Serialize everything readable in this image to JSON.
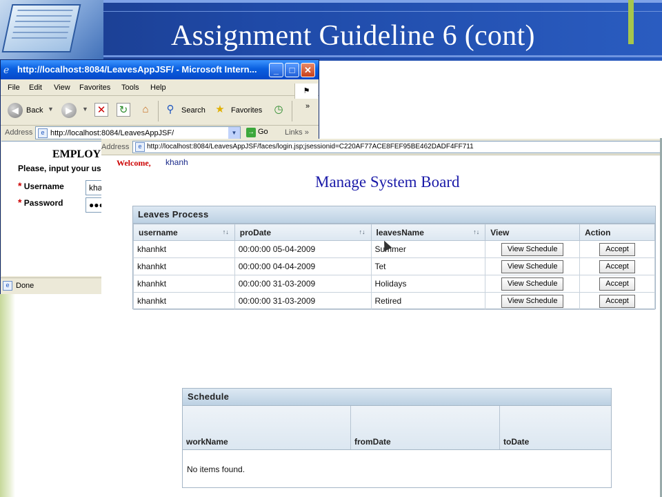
{
  "slide": {
    "title": "Assignment Guideline 6 (cont)"
  },
  "ie_window": {
    "title": "http://localhost:8084/LeavesAppJSF/ - Microsoft Intern...",
    "controls": {
      "minimize": "_",
      "maximize": "□",
      "close": "✕"
    },
    "menu": [
      "File",
      "Edit",
      "View",
      "Favorites",
      "Tools",
      "Help"
    ],
    "toolbar": {
      "back": "Back",
      "search": "Search",
      "favorites": "Favorites",
      "more": "»"
    },
    "address_label": "Address",
    "address_value": "http://localhost:8084/LeavesAppJSF/",
    "go": "Go",
    "links": "Links",
    "links_more": "»",
    "page": {
      "title": "EMPLOY",
      "instruction": "Please, input your use",
      "username_label": "Username",
      "username_value": "kha",
      "password_label": "Password",
      "password_value": "●●●"
    },
    "status": "Done"
  },
  "front_window": {
    "address_label": "Address",
    "address_value": "http://localhost:8084/LeavesAppJSF/faces/login.jsp;jsessionid=C220AF77ACE8FEF95BE462DADF4FF711",
    "welcome": "Welcome,",
    "user": "khanh",
    "board_title": "Manage System Board"
  },
  "leaves_table": {
    "title": "Leaves Process",
    "columns": [
      "username",
      "proDate",
      "leavesName",
      "View",
      "Action"
    ],
    "rows": [
      {
        "username": "khanhkt",
        "proDate": "00:00:00 05-04-2009",
        "leavesName": "Summer",
        "view": "View Schedule",
        "action": "Accept"
      },
      {
        "username": "khanhkt",
        "proDate": "00:00:00 04-04-2009",
        "leavesName": "Tet",
        "view": "View Schedule",
        "action": "Accept"
      },
      {
        "username": "khanhkt",
        "proDate": "00:00:00 31-03-2009",
        "leavesName": "Holidays",
        "view": "View Schedule",
        "action": "Accept"
      },
      {
        "username": "khanhkt",
        "proDate": "00:00:00 31-03-2009",
        "leavesName": "Retired",
        "view": "View Schedule",
        "action": "Accept"
      }
    ]
  },
  "schedule_table": {
    "title": "Schedule",
    "columns": [
      "workName",
      "fromDate",
      "toDate"
    ],
    "empty_message": "No items found."
  }
}
